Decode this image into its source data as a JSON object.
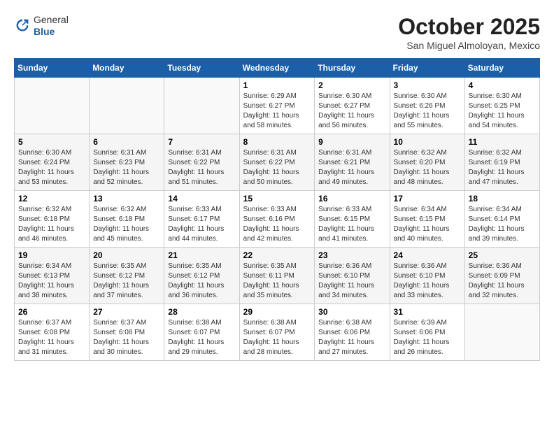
{
  "header": {
    "logo": {
      "general": "General",
      "blue": "Blue"
    },
    "month": "October 2025",
    "location": "San Miguel Almoloyan, Mexico"
  },
  "weekdays": [
    "Sunday",
    "Monday",
    "Tuesday",
    "Wednesday",
    "Thursday",
    "Friday",
    "Saturday"
  ],
  "weeks": [
    [
      {
        "day": "",
        "info": ""
      },
      {
        "day": "",
        "info": ""
      },
      {
        "day": "",
        "info": ""
      },
      {
        "day": "1",
        "info": "Sunrise: 6:29 AM\nSunset: 6:27 PM\nDaylight: 11 hours\nand 58 minutes."
      },
      {
        "day": "2",
        "info": "Sunrise: 6:30 AM\nSunset: 6:27 PM\nDaylight: 11 hours\nand 56 minutes."
      },
      {
        "day": "3",
        "info": "Sunrise: 6:30 AM\nSunset: 6:26 PM\nDaylight: 11 hours\nand 55 minutes."
      },
      {
        "day": "4",
        "info": "Sunrise: 6:30 AM\nSunset: 6:25 PM\nDaylight: 11 hours\nand 54 minutes."
      }
    ],
    [
      {
        "day": "5",
        "info": "Sunrise: 6:30 AM\nSunset: 6:24 PM\nDaylight: 11 hours\nand 53 minutes."
      },
      {
        "day": "6",
        "info": "Sunrise: 6:31 AM\nSunset: 6:23 PM\nDaylight: 11 hours\nand 52 minutes."
      },
      {
        "day": "7",
        "info": "Sunrise: 6:31 AM\nSunset: 6:22 PM\nDaylight: 11 hours\nand 51 minutes."
      },
      {
        "day": "8",
        "info": "Sunrise: 6:31 AM\nSunset: 6:22 PM\nDaylight: 11 hours\nand 50 minutes."
      },
      {
        "day": "9",
        "info": "Sunrise: 6:31 AM\nSunset: 6:21 PM\nDaylight: 11 hours\nand 49 minutes."
      },
      {
        "day": "10",
        "info": "Sunrise: 6:32 AM\nSunset: 6:20 PM\nDaylight: 11 hours\nand 48 minutes."
      },
      {
        "day": "11",
        "info": "Sunrise: 6:32 AM\nSunset: 6:19 PM\nDaylight: 11 hours\nand 47 minutes."
      }
    ],
    [
      {
        "day": "12",
        "info": "Sunrise: 6:32 AM\nSunset: 6:18 PM\nDaylight: 11 hours\nand 46 minutes."
      },
      {
        "day": "13",
        "info": "Sunrise: 6:32 AM\nSunset: 6:18 PM\nDaylight: 11 hours\nand 45 minutes."
      },
      {
        "day": "14",
        "info": "Sunrise: 6:33 AM\nSunset: 6:17 PM\nDaylight: 11 hours\nand 44 minutes."
      },
      {
        "day": "15",
        "info": "Sunrise: 6:33 AM\nSunset: 6:16 PM\nDaylight: 11 hours\nand 42 minutes."
      },
      {
        "day": "16",
        "info": "Sunrise: 6:33 AM\nSunset: 6:15 PM\nDaylight: 11 hours\nand 41 minutes."
      },
      {
        "day": "17",
        "info": "Sunrise: 6:34 AM\nSunset: 6:15 PM\nDaylight: 11 hours\nand 40 minutes."
      },
      {
        "day": "18",
        "info": "Sunrise: 6:34 AM\nSunset: 6:14 PM\nDaylight: 11 hours\nand 39 minutes."
      }
    ],
    [
      {
        "day": "19",
        "info": "Sunrise: 6:34 AM\nSunset: 6:13 PM\nDaylight: 11 hours\nand 38 minutes."
      },
      {
        "day": "20",
        "info": "Sunrise: 6:35 AM\nSunset: 6:12 PM\nDaylight: 11 hours\nand 37 minutes."
      },
      {
        "day": "21",
        "info": "Sunrise: 6:35 AM\nSunset: 6:12 PM\nDaylight: 11 hours\nand 36 minutes."
      },
      {
        "day": "22",
        "info": "Sunrise: 6:35 AM\nSunset: 6:11 PM\nDaylight: 11 hours\nand 35 minutes."
      },
      {
        "day": "23",
        "info": "Sunrise: 6:36 AM\nSunset: 6:10 PM\nDaylight: 11 hours\nand 34 minutes."
      },
      {
        "day": "24",
        "info": "Sunrise: 6:36 AM\nSunset: 6:10 PM\nDaylight: 11 hours\nand 33 minutes."
      },
      {
        "day": "25",
        "info": "Sunrise: 6:36 AM\nSunset: 6:09 PM\nDaylight: 11 hours\nand 32 minutes."
      }
    ],
    [
      {
        "day": "26",
        "info": "Sunrise: 6:37 AM\nSunset: 6:08 PM\nDaylight: 11 hours\nand 31 minutes."
      },
      {
        "day": "27",
        "info": "Sunrise: 6:37 AM\nSunset: 6:08 PM\nDaylight: 11 hours\nand 30 minutes."
      },
      {
        "day": "28",
        "info": "Sunrise: 6:38 AM\nSunset: 6:07 PM\nDaylight: 11 hours\nand 29 minutes."
      },
      {
        "day": "29",
        "info": "Sunrise: 6:38 AM\nSunset: 6:07 PM\nDaylight: 11 hours\nand 28 minutes."
      },
      {
        "day": "30",
        "info": "Sunrise: 6:38 AM\nSunset: 6:06 PM\nDaylight: 11 hours\nand 27 minutes."
      },
      {
        "day": "31",
        "info": "Sunrise: 6:39 AM\nSunset: 6:06 PM\nDaylight: 11 hours\nand 26 minutes."
      },
      {
        "day": "",
        "info": ""
      }
    ]
  ]
}
